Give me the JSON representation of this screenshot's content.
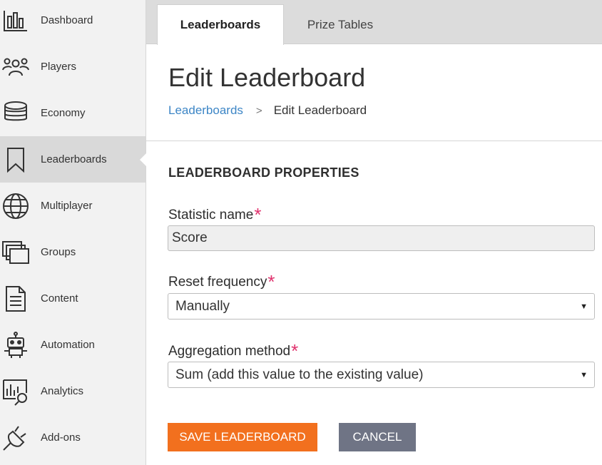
{
  "sidebar": {
    "items": [
      {
        "label": "Dashboard",
        "icon": "dashboard-icon"
      },
      {
        "label": "Players",
        "icon": "players-icon"
      },
      {
        "label": "Economy",
        "icon": "economy-icon"
      },
      {
        "label": "Leaderboards",
        "icon": "bookmark-icon",
        "active": true
      },
      {
        "label": "Multiplayer",
        "icon": "globe-icon"
      },
      {
        "label": "Groups",
        "icon": "groups-icon"
      },
      {
        "label": "Content",
        "icon": "document-icon"
      },
      {
        "label": "Automation",
        "icon": "robot-icon"
      },
      {
        "label": "Analytics",
        "icon": "analytics-icon"
      },
      {
        "label": "Add-ons",
        "icon": "plug-icon"
      }
    ]
  },
  "tabs": [
    {
      "label": "Leaderboards",
      "active": true
    },
    {
      "label": "Prize Tables",
      "active": false
    }
  ],
  "page": {
    "title": "Edit Leaderboard",
    "breadcrumb": {
      "parent": "Leaderboards",
      "separator": ">",
      "current": "Edit Leaderboard"
    }
  },
  "form": {
    "section_title": "LEADERBOARD PROPERTIES",
    "required_marker": "*",
    "statistic_name": {
      "label": "Statistic name",
      "value": "Score"
    },
    "reset_frequency": {
      "label": "Reset frequency",
      "value": "Manually"
    },
    "aggregation_method": {
      "label": "Aggregation method",
      "value": "Sum (add this value to the existing value)"
    }
  },
  "buttons": {
    "save": "SAVE LEADERBOARD",
    "cancel": "CANCEL"
  },
  "colors": {
    "accent_orange": "#f2701e",
    "link_blue": "#3d86c6",
    "required_pink": "#e0336e",
    "cancel_gray": "#6f7485"
  }
}
